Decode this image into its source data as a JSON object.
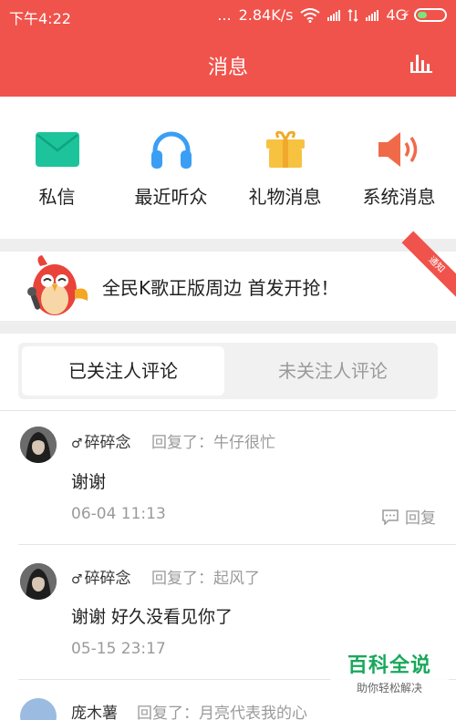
{
  "status_bar": {
    "time": "下午4:22",
    "dots": "...",
    "network_speed": "2.84K/s",
    "network_type": "4G",
    "icons": [
      "wifi-icon",
      "signal-icon",
      "battery-charging-icon"
    ]
  },
  "header": {
    "title": "消息",
    "right_icon": "bar-chart-icon"
  },
  "quick_menu": [
    {
      "label": "私信",
      "icon": "mail-icon",
      "color": "#1dc49b"
    },
    {
      "label": "最近听众",
      "icon": "headphones-icon",
      "color": "#3a9ef4"
    },
    {
      "label": "礼物消息",
      "icon": "gift-icon",
      "color": "#f6c240"
    },
    {
      "label": "系统消息",
      "icon": "speaker-icon",
      "color": "#f06a4a"
    }
  ],
  "banner": {
    "text": "全民K歌正版周边 首发开抢！",
    "ribbon": "通知"
  },
  "tabs": {
    "active": "已关注人评论",
    "inactive": "未关注人评论"
  },
  "messages": [
    {
      "user": "碎碎念",
      "reply_label": "回复了：",
      "reply_to": "牛仔很忙",
      "content": "谢谢",
      "time": "06-04 11:13",
      "reply_button": "回复"
    },
    {
      "user": "碎碎念",
      "reply_label": "回复了：",
      "reply_to": "起风了",
      "content": "谢谢 好久没看见你了",
      "time": "05-15 23:17"
    },
    {
      "user": "庞木薯",
      "reply_label": "回复了：",
      "reply_to": "月亮代表我的心"
    }
  ],
  "watermark": {
    "line1": "百科全说",
    "line2": "助你轻松解决"
  },
  "colors": {
    "accent": "#f0534b",
    "muted_text": "#9a9a9a",
    "watermark_green": "#19a85b"
  }
}
